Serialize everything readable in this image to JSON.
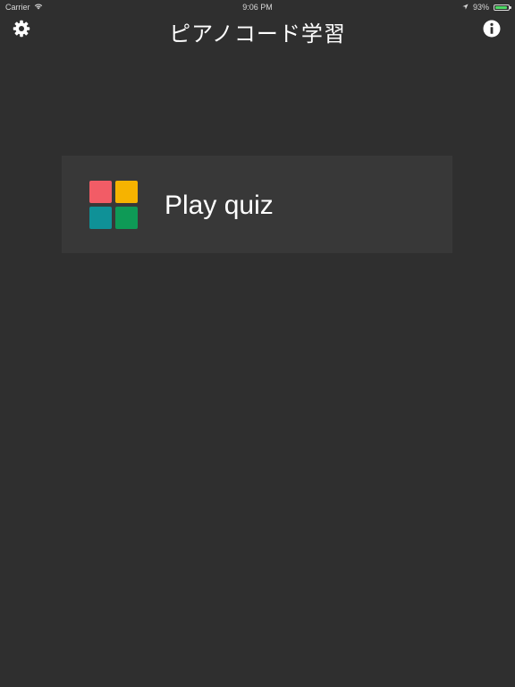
{
  "status_bar": {
    "carrier": "Carrier",
    "time": "9:06 PM",
    "battery_percent": "93%",
    "battery_level": 0.93,
    "battery_color": "#4cd964"
  },
  "nav": {
    "title": "ピアノコード学習",
    "left_icon": "gear-icon",
    "right_icon": "info-icon"
  },
  "main": {
    "quiz_button": {
      "label": "Play quiz",
      "icon": "four-tiles-icon",
      "tile_colors": [
        "#f25c66",
        "#f6b300",
        "#0f9197",
        "#0e9a56"
      ]
    }
  },
  "colors": {
    "background": "#2f2f2f",
    "card": "#383838"
  }
}
